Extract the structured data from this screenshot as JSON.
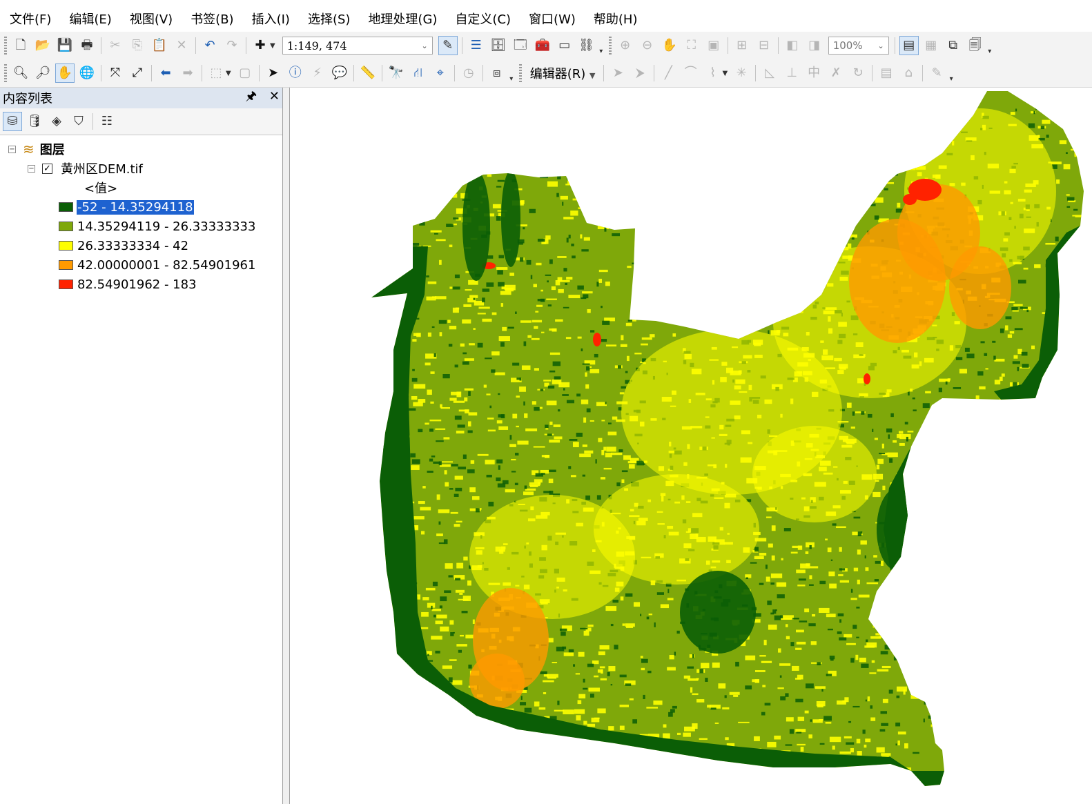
{
  "menu": [
    "文件(F)",
    "编辑(E)",
    "视图(V)",
    "书签(B)",
    "插入(I)",
    "选择(S)",
    "地理处理(G)",
    "自定义(C)",
    "窗口(W)",
    "帮助(H)"
  ],
  "toolbar": {
    "scale": "1:149, 474",
    "zoom_percent": "100%",
    "editor_label": "编辑器(R)"
  },
  "toc": {
    "title": "内容列表",
    "root_label": "图层",
    "layer_name": "黄州区DEM.tif",
    "layer_checked": true,
    "field_label": "<值>",
    "legend": [
      {
        "label": "-52 - 14.35294118",
        "color": "#0b5e06",
        "selected": true
      },
      {
        "label": "14.35294119 - 26.33333333",
        "color": "#7fa80a",
        "selected": false
      },
      {
        "label": "26.33333334 - 42",
        "color": "#ffff00",
        "selected": false
      },
      {
        "label": "42.00000001 - 82.54901961",
        "color": "#ff9a00",
        "selected": false
      },
      {
        "label": "82.54901962 - 183",
        "color": "#ff2200",
        "selected": false
      }
    ]
  }
}
